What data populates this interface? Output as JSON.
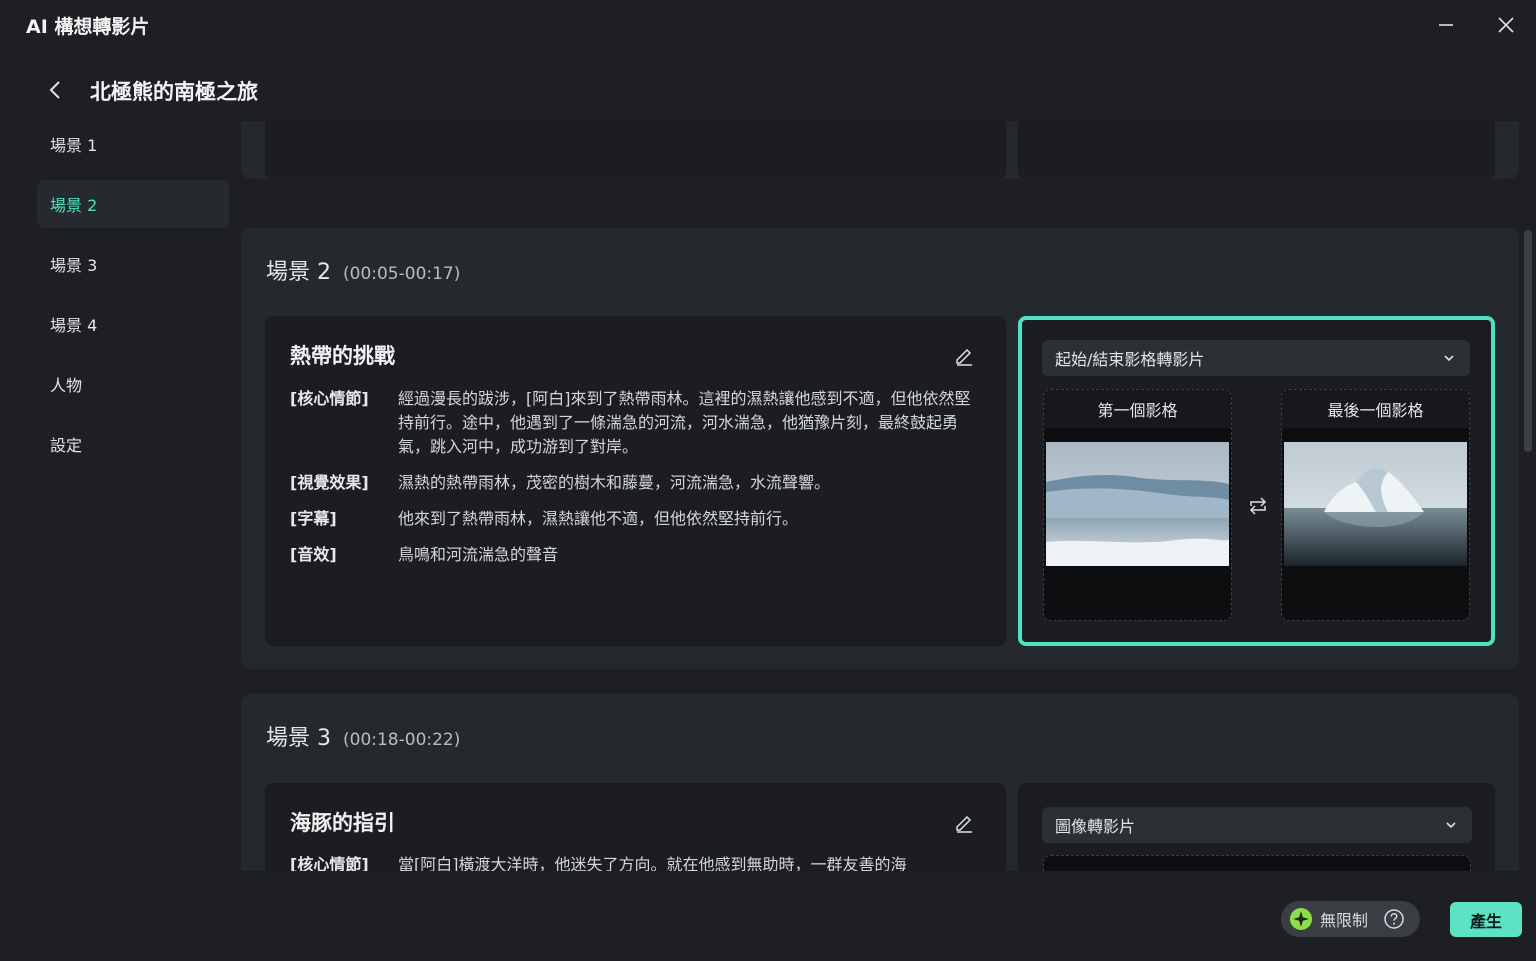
{
  "window": {
    "title": "AI 構想轉影片"
  },
  "header": {
    "title": "北極熊的南極之旅"
  },
  "sidebar": {
    "items": [
      {
        "label": "場景 1"
      },
      {
        "label": "場景 2"
      },
      {
        "label": "場景 3"
      },
      {
        "label": "場景 4"
      },
      {
        "label": "人物"
      },
      {
        "label": "設定"
      }
    ],
    "active_index": 1
  },
  "scenes": [
    {
      "name": "場景 2",
      "time": "(00:05-00:17)",
      "title": "熱帶的挑戰",
      "rows": [
        {
          "label": "[核心情節]",
          "value": "經過漫長的跋涉，[阿白]來到了熱帶雨林。這裡的濕熱讓他感到不適，但他依然堅持前行。途中，他遇到了一條湍急的河流，河水湍急，他猶豫片刻，最終鼓起勇氣，跳入河中，成功游到了對岸。"
        },
        {
          "label": "[視覺效果]",
          "value": "濕熱的熱帶雨林，茂密的樹木和藤蔓，河流湍急，水流聲響。"
        },
        {
          "label": "[字幕]",
          "value": "他來到了熱帶雨林，濕熱讓他不適，但他依然堅持前行。"
        },
        {
          "label": "[音效]",
          "value": "鳥鳴和河流湍急的聲音"
        }
      ],
      "mode": "起始/結束影格轉影片",
      "first_frame_label": "第一個影格",
      "last_frame_label": "最後一個影格"
    },
    {
      "name": "場景 3",
      "time": "(00:18-00:22)",
      "title": "海豚的指引",
      "rows": [
        {
          "label": "[核心情節]",
          "value": "當[阿白]橫渡大洋時，他迷失了方向。就在他感到無助時，一群友善的海"
        }
      ],
      "mode": "圖像轉影片"
    }
  ],
  "footer": {
    "quota_label": "無限制",
    "generate_label": "產生"
  },
  "colors": {
    "accent": "#4ee2c3",
    "generate_button": "#5de2c5",
    "background": "#1d1f22",
    "card": "#25282c",
    "panel": "#1b1d20"
  },
  "icons": [
    "minimize-icon",
    "close-icon",
    "back-arrow-icon",
    "edit-pencil-icon",
    "chevron-down-icon",
    "swap-icon",
    "sparkle-icon",
    "help-icon"
  ]
}
